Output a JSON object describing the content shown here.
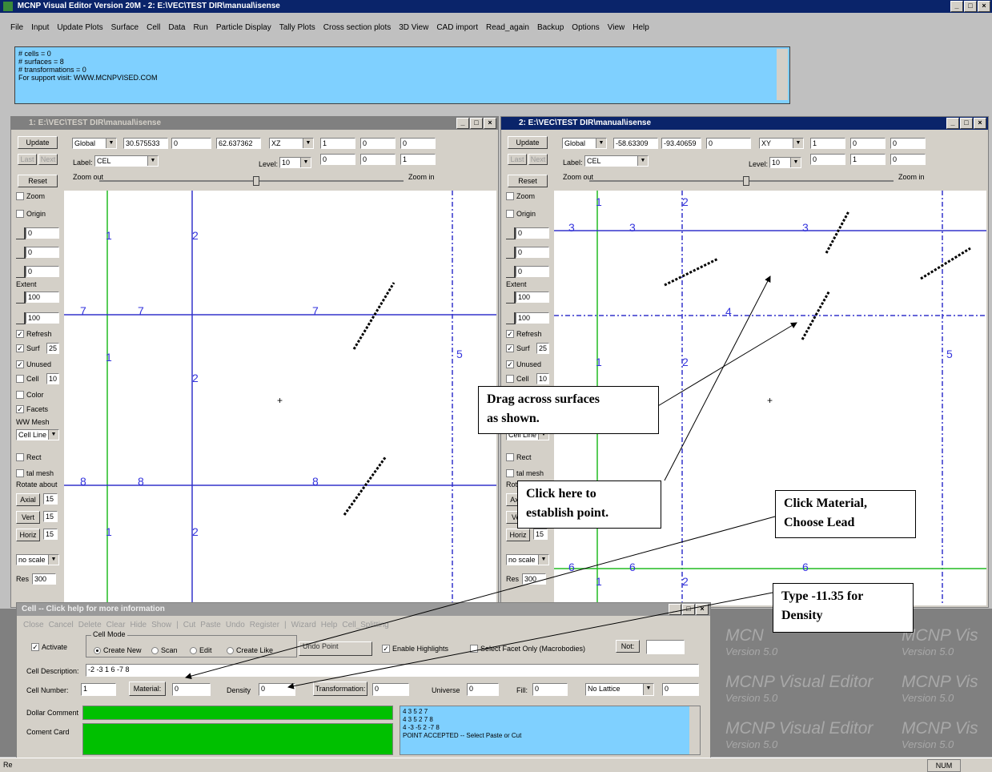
{
  "app": {
    "title": "MCNP Visual Editor Version 20M - 2: E:\\VEC\\TEST DIR\\manual\\isense",
    "menu": [
      "File",
      "Input",
      "Update Plots",
      "Surface",
      "Cell",
      "Data",
      "Run",
      "Particle Display",
      "Tally Plots",
      "Cross section plots",
      "3D View",
      "CAD import",
      "Read_again",
      "Backup",
      "Options",
      "View",
      "Help"
    ],
    "info": [
      "# cells = 0",
      "# surfaces = 8",
      "# transformations = 0",
      "For support visit: WWW.MCNPVISED.COM"
    ]
  },
  "plot1": {
    "title": "1: E:\\VEC\\TEST DIR\\manual\\isense",
    "update": "Update",
    "last": "Last",
    "next": "Next",
    "reset": "Reset",
    "coord": "Global",
    "v1": "30.575533",
    "v2": "0",
    "v3": "62.637362",
    "plane": "XZ",
    "r1": [
      "1",
      "0",
      "0"
    ],
    "r2": [
      "0",
      "0",
      "1"
    ],
    "label_lbl": "Label:",
    "label_val": "CEL",
    "level_lbl": "Level:",
    "level_val": "10",
    "zoom_out": "Zoom out",
    "zoom_in": "Zoom in",
    "labels": [
      "1",
      "2",
      "7",
      "7",
      "7",
      "1",
      "2",
      "8",
      "8",
      "8",
      "1",
      "2",
      "5"
    ]
  },
  "plot2": {
    "title": "2: E:\\VEC\\TEST DIR\\manual\\isense",
    "update": "Update",
    "last": "Last",
    "next": "Next",
    "reset": "Reset",
    "coord": "Global",
    "v1": "-58.63309",
    "v2": "-93.40659",
    "v3": "0",
    "plane": "XY",
    "r1": [
      "1",
      "0",
      "0"
    ],
    "r2": [
      "0",
      "1",
      "0"
    ],
    "label_lbl": "Label:",
    "label_val": "CEL",
    "level_lbl": "Level:",
    "level_val": "10",
    "zoom_out": "Zoom out",
    "zoom_in": "Zoom in",
    "labels": [
      "1",
      "2",
      "3",
      "3",
      "3",
      "4",
      "1",
      "2",
      "5",
      "6",
      "6",
      "6",
      "1",
      "2"
    ]
  },
  "side": {
    "zoom": "Zoom",
    "origin": "Origin",
    "val0": "0",
    "extent": "Extent",
    "val100": "100",
    "refresh": "Refresh",
    "surf": "Surf",
    "surf_n": "25",
    "unused": "Unused",
    "cell": "Cell",
    "cell_n": "10",
    "color": "Color",
    "facets": "Facets",
    "ww": "WW Mesh",
    "cellline": "Cell Line",
    "rect": "Rect",
    "talmesh": "tal mesh",
    "rotate": "Rotate about",
    "axial": "Axial",
    "vert": "Vert",
    "horiz": "Horiz",
    "rot_n": "15",
    "noscale": "no scale",
    "res": "Res",
    "res_n": "300"
  },
  "cell": {
    "title": "Cell -- Click help for more information",
    "toolbar": [
      "Close",
      "Cancel",
      "Delete",
      "Clear",
      "Hide",
      "Show",
      "|",
      "Cut",
      "Paste",
      "Undo",
      "Register",
      "|",
      "Wizard",
      "Help",
      "Cell_Splitting"
    ],
    "activate": "Activate",
    "mode": "Cell Mode",
    "modes": [
      "Create New",
      "Scan",
      "Edit",
      "Create Like"
    ],
    "undo_point": "Undo Point",
    "highlights": "Enable Highlights",
    "facet": "Select Facet Only (Macrobodies)",
    "not": "Not:",
    "desc_lbl": "Cell Description:",
    "desc_val": "-2 -3 1 6 -7 8",
    "num_lbl": "Cell Number:",
    "num_val": "1",
    "mat_btn": "Material:",
    "mat_val": "0",
    "dens_lbl": "Density",
    "dens_val": "0",
    "trans_btn": "Transformation:",
    "trans_val": "0",
    "univ_lbl": "Universe",
    "univ_val": "0",
    "fill_lbl": "Fill:",
    "fill_val": "0",
    "lattice": "No Lattice",
    "lat_val": "0",
    "dollar": "Dollar Comment",
    "coment": "Coment Card",
    "log": [
      "4 3 5 2 7",
      "4 3 5 2 7 8",
      "4 -3 -5 2 -7 8",
      "POINT ACCEPTED -- Select Paste or Cut"
    ]
  },
  "watermark": {
    "name": "MCNP Visual Editor",
    "short": "MCNP Vis",
    "ver": "Version 5.0",
    "cut": "MCN"
  },
  "status": {
    "left": "Re",
    "num": "NUM"
  },
  "callouts": {
    "drag": [
      "Drag across surfaces",
      "as shown."
    ],
    "click": [
      "Click here to",
      "establish point."
    ],
    "material": [
      "Click Material,",
      "Choose Lead"
    ],
    "density": [
      "Type -11.35 for",
      "Density"
    ]
  }
}
